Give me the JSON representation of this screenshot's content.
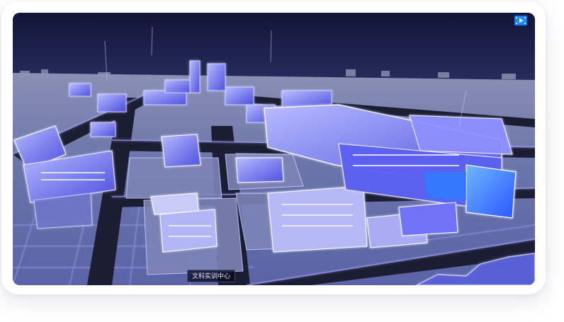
{
  "scene": {
    "caption": "文科实训中心",
    "fullscreen_icon": "video-play-icon",
    "colors": {
      "sky": "#141a3a",
      "ground": "#6e7aa8",
      "road": "#1b1e33",
      "glow": "#8f8cff",
      "building": "#5a5cff",
      "accent": "#1e88ff"
    }
  }
}
